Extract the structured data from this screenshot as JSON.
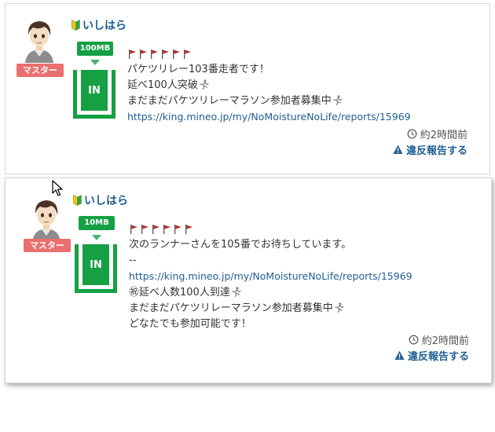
{
  "posts": [
    {
      "username": "いしはら",
      "rank": "マスター",
      "data_amount": "100MB",
      "data_direction": "IN",
      "lines": [
        "パケツリレー103番走者です！",
        "延べ100人突破",
        "まだまだパケツリレーマラソン参加者募集中"
      ],
      "link": "https://king.mineo.jp/my/NoMoistureNoLife/reports/15969",
      "timestamp": "約2時間前",
      "report_label": "違反報告する"
    },
    {
      "username": "いしはら",
      "rank": "マスター",
      "data_amount": "10MB",
      "data_direction": "IN",
      "line1": "次のランナーさんを105番でお待ちしています。",
      "separator": "--",
      "link": "https://king.mineo.jp/my/NoMoistureNoLife/reports/15969",
      "line3": "㊗延べ人数100人到達",
      "line4": "まだまだパケツリレーマラソン参加者募集中",
      "line5": "どなたでも参加可能です！",
      "timestamp": "約2時間前",
      "report_label": "違反報告する"
    }
  ],
  "colors": {
    "link": "#1f5e93",
    "badge_green": "#15a043",
    "rank_red": "#ea6f6f",
    "flag_red": "#b5312c"
  },
  "icons": [
    "beginner-mark-icon",
    "flag-icon",
    "runner-icon",
    "clock-icon",
    "warning-icon",
    "cursor-icon"
  ]
}
